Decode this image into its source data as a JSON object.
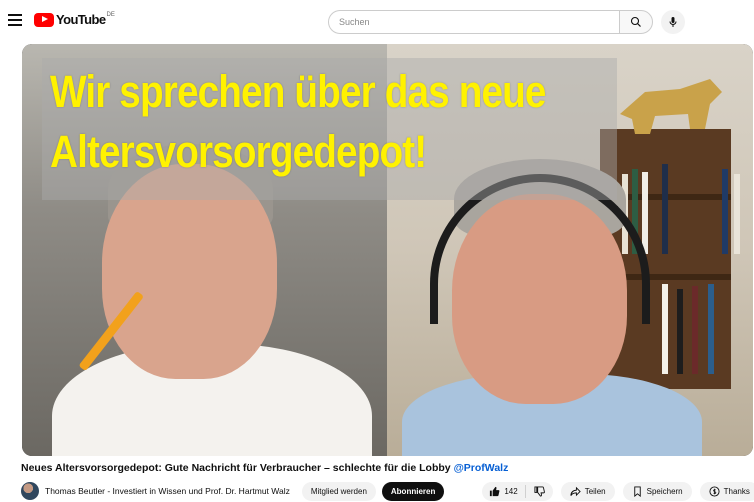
{
  "header": {
    "logo_text": "YouTube",
    "logo_region": "DE",
    "search_placeholder": "Suchen"
  },
  "video": {
    "overlay_line1": "Wir sprechen über das neue",
    "overlay_line2": "Altersvorsorgedepot!"
  },
  "info": {
    "title": "Neues Altersvorsorgedepot: Gute Nachricht für Verbraucher – schlechte für die Lobby",
    "hashtag": "@ProfWalz",
    "channel_name": "Thomas Beutler - Investiert in Wissen und Prof. Dr. Hartmut Walz",
    "member_label": "Mitglied werden",
    "subscribe_label": "Abonnieren",
    "like_count": "142",
    "share_label": "Teilen",
    "save_label": "Speichern",
    "thanks_label": "Thanks",
    "more_label": "..."
  },
  "colors": {
    "brand_red": "#ff0000",
    "overlay_yellow": "#fff200",
    "link_blue": "#065fd4"
  }
}
